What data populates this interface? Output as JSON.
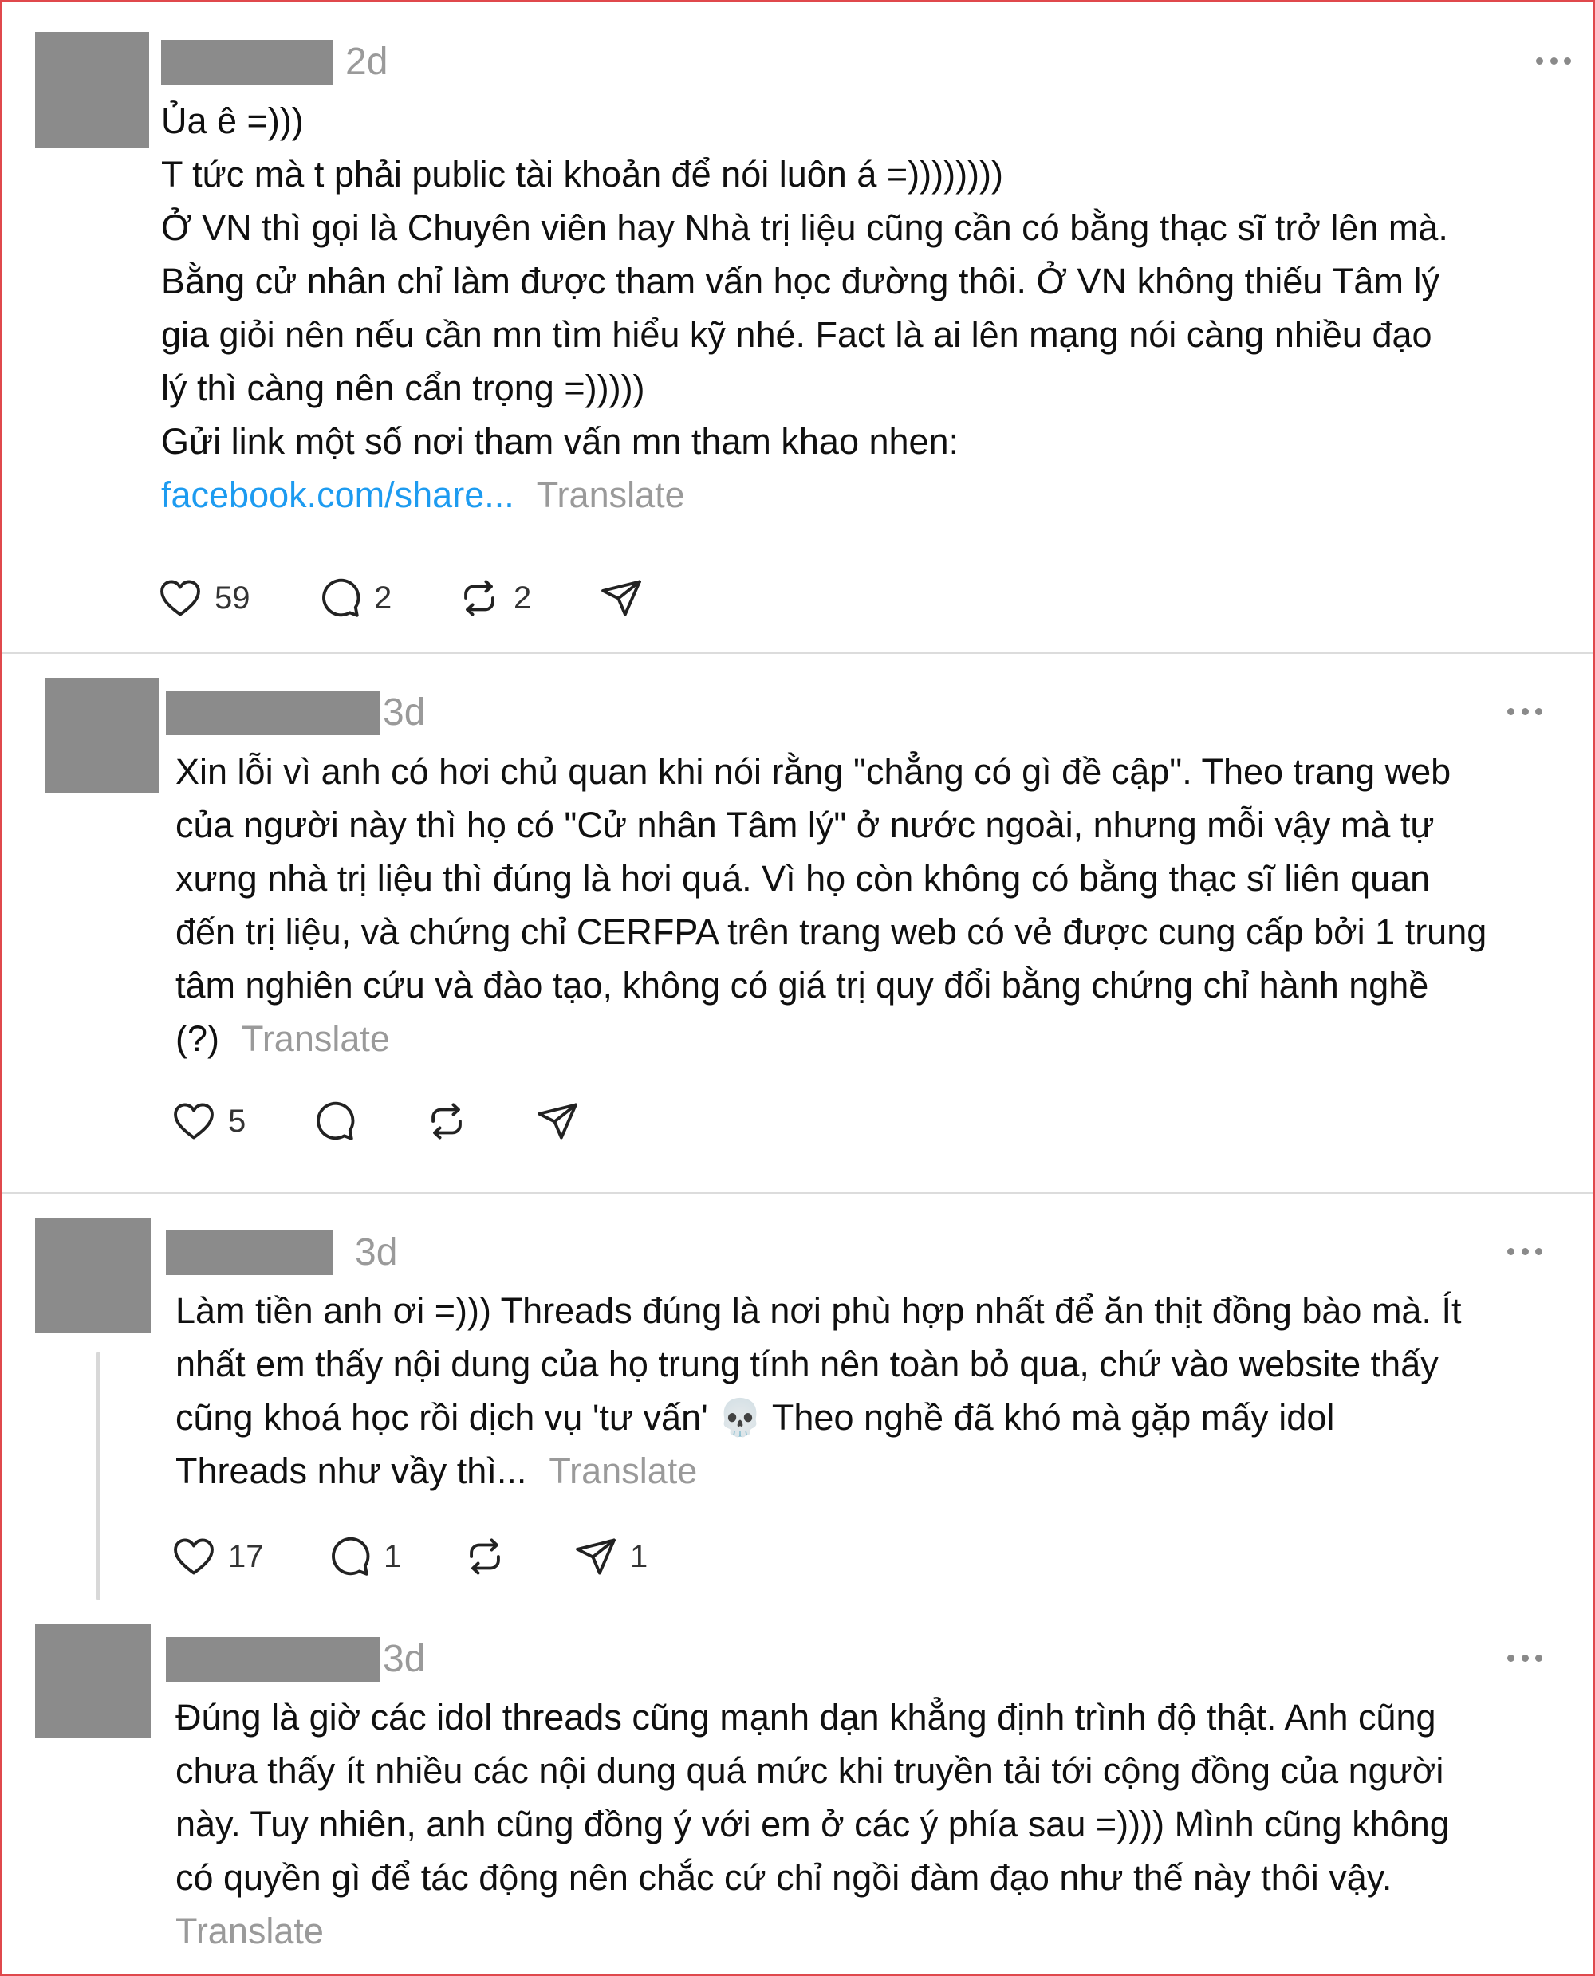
{
  "posts": [
    {
      "time": "2d",
      "lines": [
        "Ủa ê =)))",
        "T tức mà t phải public tài khoản để nói luôn á =))))))))",
        "Ở VN thì gọi là Chuyên viên hay Nhà trị liệu cũng cần có bằng thạc sĩ trở lên mà.",
        "Bằng cử nhân chỉ làm được tham vấn học đường thôi. Ở VN không thiếu Tâm lý",
        "gia giỏi nên nếu cần mn tìm hiểu kỹ nhé. Fact là ai lên mạng nói càng nhiều đạo",
        "lý thì càng nên cẩn trọng =)))))",
        "Gửi link một số nơi tham vấn mn tham khao nhen:"
      ],
      "link": "facebook.com/share...",
      "translate": "Translate",
      "likes": "59",
      "replies": "2",
      "reposts": "2",
      "shares": ""
    },
    {
      "time": "3d",
      "lines": [
        "Xin lỗi vì anh có hơi chủ quan khi nói rằng \"chẳng có gì đề cập\". Theo trang web",
        "của người này thì họ có \"Cử nhân Tâm lý\" ở nước ngoài, nhưng mỗi vậy mà tự",
        "xưng nhà trị liệu thì đúng là hơi quá. Vì họ còn không có bằng thạc sĩ liên quan",
        "đến trị liệu, và chứng chỉ CERFPA trên trang web có vẻ được cung cấp bởi 1 trung",
        "tâm nghiên cứu và đào tạo, không có giá trị quy đổi bằng chứng chỉ hành nghề"
      ],
      "last_line": "(?)",
      "translate": "Translate",
      "likes": "5",
      "replies": "",
      "reposts": "",
      "shares": ""
    },
    {
      "time": "3d",
      "lines": [
        "Làm tiền anh ơi =))) Threads đúng là nơi phù hợp nhất để ăn thịt đồng bào mà. Ít",
        "nhất em thấy nội dung của họ trung tính nên toàn bỏ qua, chứ vào website thấy",
        "cũng khoá học rồi dịch vụ 'tư vấn' 💀 Theo nghề đã khó mà gặp mấy idol"
      ],
      "last_line": "Threads như vầy thì...",
      "translate": "Translate",
      "likes": "17",
      "replies": "1",
      "reposts": "",
      "shares": "1"
    },
    {
      "time": "3d",
      "lines": [
        "Đúng là giờ các idol threads cũng mạnh dạn khẳng định trình độ thật. Anh cũng",
        "chưa thấy ít nhiều các nội dung quá mức khi truyền tải tới cộng đồng của người",
        "này. Tuy nhiên, anh cũng đồng ý với em ở các ý phía sau =)))) Mình cũng không",
        "có quyền gì để tác động nên chắc cứ chỉ ngồi đàm đạo như thế này thôi vậy."
      ],
      "translate": "Translate"
    }
  ],
  "icons": {
    "like": "heart-icon",
    "reply": "comment-icon",
    "repost": "repost-icon",
    "share": "send-icon",
    "more": "more-options-icon"
  }
}
